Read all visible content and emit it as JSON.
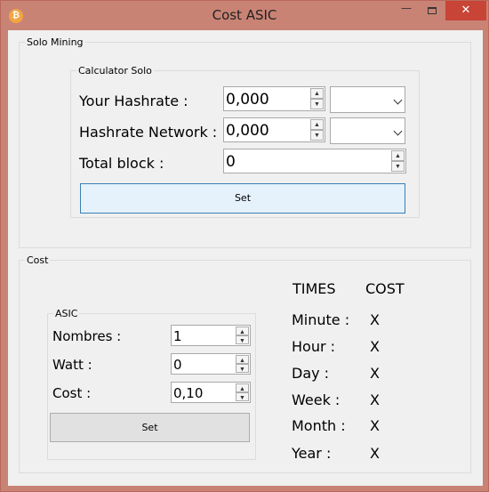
{
  "window": {
    "title": "Cost ASIC",
    "icon": "bitcoin-icon",
    "min_glyph": "—",
    "close_glyph": "✕"
  },
  "solo": {
    "legend": "Solo Mining",
    "calc": {
      "legend": "Calculator Solo",
      "hashrate_label": "Your Hashrate :",
      "hashrate_value": "0,000",
      "network_label": "Hashrate  Network :",
      "network_value": "0,000",
      "total_block_label": "Total block :",
      "total_block_value": "0",
      "set_label": "Set"
    }
  },
  "cost": {
    "legend": "Cost",
    "asic": {
      "legend": "ASIC",
      "nombres_label": "Nombres :",
      "nombres_value": "1",
      "watt_label": "Watt :",
      "watt_value": "0",
      "cost_label": "Cost :",
      "cost_value": "0,10",
      "set_label": "Set"
    },
    "table": {
      "times_header": "TIMES",
      "cost_header": "COST",
      "rows": [
        {
          "label": "Minute :",
          "value": "X"
        },
        {
          "label": "Hour :",
          "value": "X"
        },
        {
          "label": "Day :",
          "value": "X"
        },
        {
          "label": "Week :",
          "value": "X"
        },
        {
          "label": "Month :",
          "value": "X"
        },
        {
          "label": "Year :",
          "value": "X"
        }
      ]
    }
  },
  "icons": {
    "spin_up": "▲",
    "spin_down": "▼"
  },
  "colors": {
    "titlebar": "#c98375",
    "close_button": "#c84437",
    "client": "#f0f0f0"
  }
}
